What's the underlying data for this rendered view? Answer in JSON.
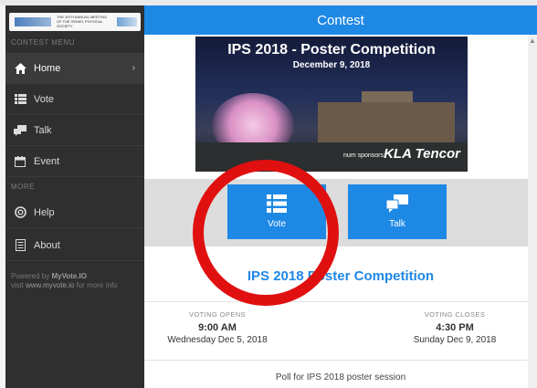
{
  "sidebar": {
    "logo_text": "THE 34TH ANNUAL MEETING OF THE ISRAEL PHYSICAL SOCIETY",
    "section_menu": "CONTEST MENU",
    "section_more": "MORE",
    "items": [
      {
        "label": "Home",
        "icon": "home-icon",
        "chevron": "›"
      },
      {
        "label": "Vote",
        "icon": "list-icon"
      },
      {
        "label": "Talk",
        "icon": "chat-icon"
      },
      {
        "label": "Event",
        "icon": "calendar-icon"
      }
    ],
    "more_items": [
      {
        "label": "Help",
        "icon": "lifebuoy-icon"
      },
      {
        "label": "About",
        "icon": "document-icon"
      }
    ],
    "powered_prefix": "Powered by ",
    "powered_brand": "MyVote.IO",
    "powered_visit": "visit ",
    "powered_link": "www.myvote.io",
    "powered_suffix": " for more info"
  },
  "header": {
    "title": "Contest"
  },
  "banner": {
    "title": "IPS 2018 - Poster Competition",
    "date": "December 9, 2018",
    "sponsor_text": "num sponsors",
    "sponsor_logo": "KLA Tencor"
  },
  "tiles": {
    "vote_label": "Vote",
    "talk_label": "Talk"
  },
  "contest_title": "IPS 2018 Poster Competition",
  "voting": {
    "opens_label": "VOTING OPENS",
    "opens_time": "9:00 AM",
    "opens_date": "Wednesday Dec 5, 2018",
    "closes_label": "VOTING CLOSES",
    "closes_time": "4:30 PM",
    "closes_date": "Sunday Dec 9, 2018"
  },
  "description": "Poll for IPS 2018 poster session",
  "colors": {
    "accent": "#1e88e5",
    "sidebar": "#2f2f2f",
    "highlight_circle": "#e01010"
  }
}
